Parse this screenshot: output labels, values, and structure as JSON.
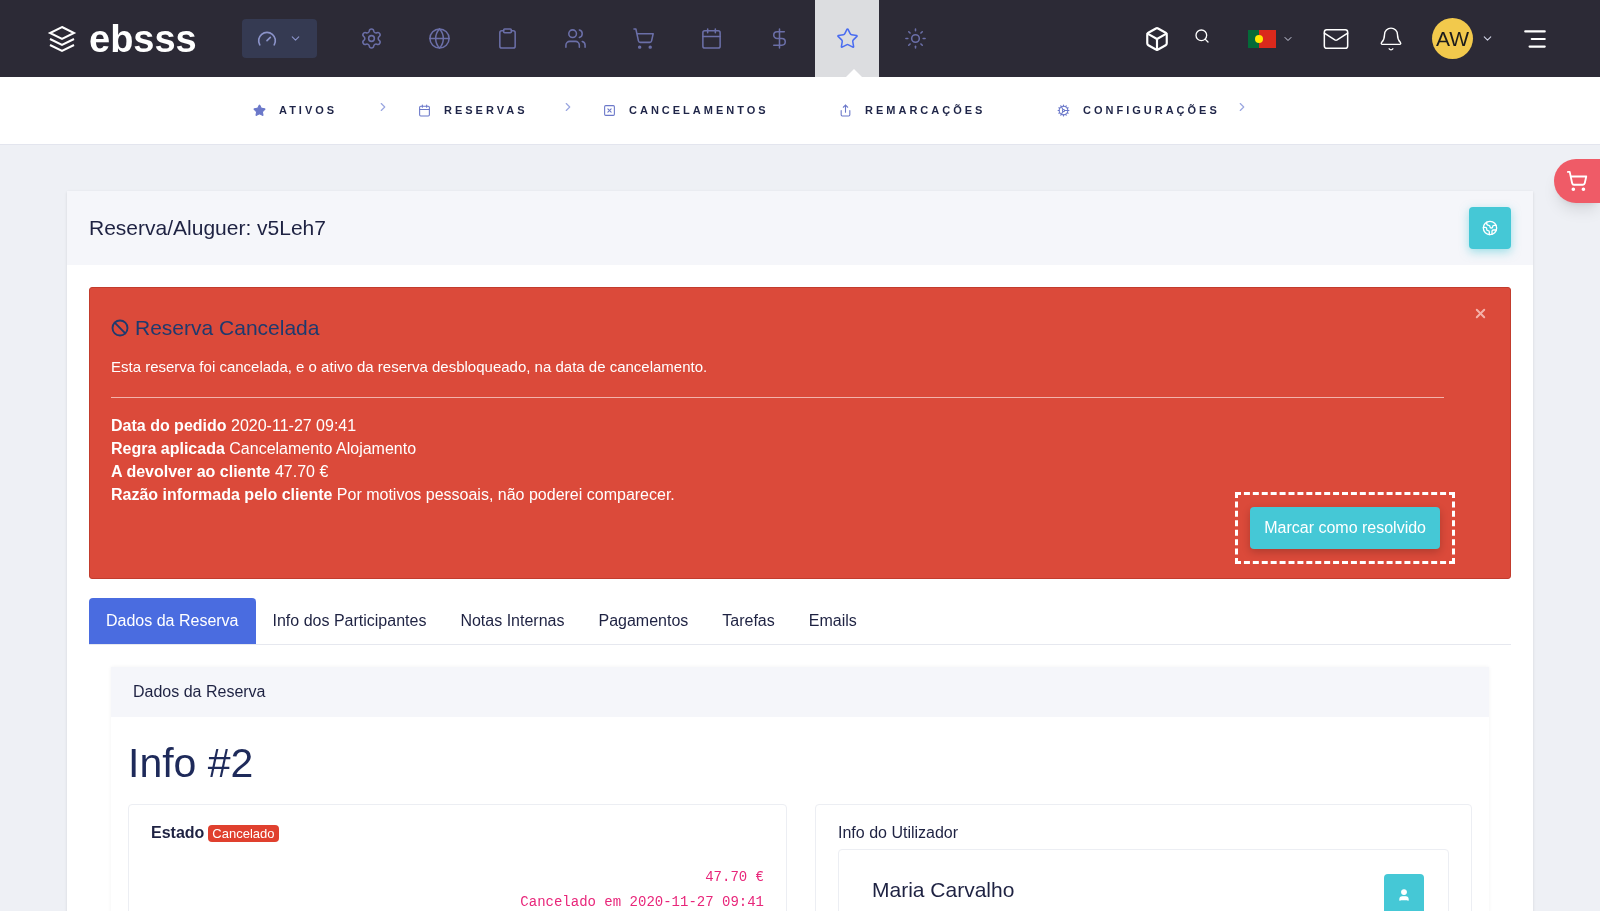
{
  "brand": "ebsss",
  "nav_icons": [
    {
      "selected": false
    },
    {
      "selected": false
    },
    {
      "selected": false
    },
    {
      "selected": false
    },
    {
      "selected": false
    },
    {
      "selected": false
    },
    {
      "selected": false
    },
    {
      "selected": true
    },
    {
      "selected": false
    }
  ],
  "user": {
    "initials": "AW"
  },
  "subnav": [
    {
      "label": "ATIVOS",
      "chevron": true
    },
    {
      "label": "RESERVAS",
      "chevron": true
    },
    {
      "label": "CANCELAMENTOS",
      "chevron": false
    },
    {
      "label": "REMARCAÇÕES",
      "chevron": false
    },
    {
      "label": "CONFIGURAÇÕES",
      "chevron": true
    }
  ],
  "page_title": "Reserva/Aluguer: v5Leh7",
  "alert": {
    "title": "Reserva Cancelada",
    "message": "Esta reserva foi cancelada, e o ativo da reserva desbloqueado, na data de cancelamento.",
    "fields": [
      {
        "label": "Data do pedido",
        "value": "2020-11-27 09:41"
      },
      {
        "label": "Regra aplicada",
        "value": "Cancelamento Alojamento"
      },
      {
        "label": "A devolver ao cliente",
        "value": "47.70 €"
      },
      {
        "label": "Razão informada pelo cliente",
        "value": "Por motivos pessoais, não poderei comparecer."
      }
    ],
    "button": "Marcar como resolvido"
  },
  "tabs": [
    {
      "label": "Dados da Reserva",
      "selected": true
    },
    {
      "label": "Info dos Participantes",
      "selected": false
    },
    {
      "label": "Notas Internas",
      "selected": false
    },
    {
      "label": "Pagamentos",
      "selected": false
    },
    {
      "label": "Tarefas",
      "selected": false
    },
    {
      "label": "Emails",
      "selected": false
    }
  ],
  "panel": {
    "title": "Dados da Reserva",
    "heading": "Info #2",
    "status": {
      "label": "Estado",
      "badge": "Cancelado",
      "amount": "47.70 €",
      "cancelled_at": "Cancelado em 2020-11-27 09:41"
    },
    "user": {
      "title": "Info do Utilizador",
      "name": "Maria Carvalho"
    }
  }
}
